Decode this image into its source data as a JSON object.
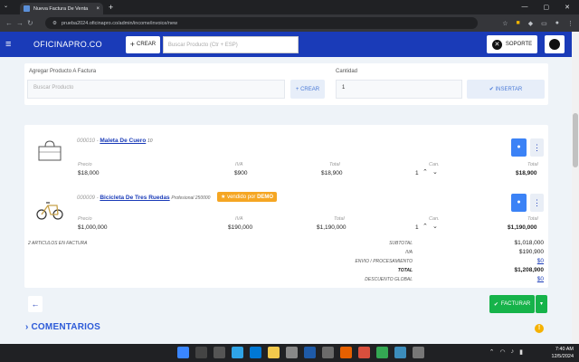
{
  "browser": {
    "tab_title": "Nueva Factura De Venta",
    "tab_close": "×",
    "new_tab": "+",
    "url": "prueba2024.oficinapro.co/admin/income/invoice/new"
  },
  "header": {
    "logo": "OFICINAPRO.CO",
    "crear_label": "CREAR",
    "search_placeholder": "Buscar Producto (Ctr + ESP)",
    "soporte_label": "SOPORTE"
  },
  "add_product": {
    "label": "Agregar Producto A Factura",
    "placeholder": "Buscar Producto",
    "crear_label": "+ CREAR",
    "cantidad_label": "Cantidad",
    "cantidad_value": "1",
    "insertar_label": "✔ INSERTAR"
  },
  "columns": {
    "precio": "Precio",
    "iva": "IVA",
    "total": "Total",
    "can": "Can."
  },
  "items": [
    {
      "code": "000010 - ",
      "name": "Maleta De Cuero",
      "extra": "10",
      "precio": "$18,000",
      "iva": "$900",
      "total": "$18,900",
      "qty": "1",
      "line_total": "$18,900"
    },
    {
      "code": "000009 - ",
      "name": "Bicicleta De Tres Ruedas",
      "extra": "Profesional 250000",
      "badge_text": "vendido por ",
      "badge_strong": "DEMO",
      "precio": "$1,000,000",
      "iva": "$190,000",
      "total": "$1,190,000",
      "qty": "1",
      "line_total": "$1,190,000"
    }
  ],
  "summary": {
    "count_label": "2 ARTICULOS EN FACTURA",
    "subtotal_label": "SUBTOTAL",
    "subtotal": "$1,018,000",
    "iva_label": "IVA",
    "iva": "$190,900",
    "envio_label": "ENVIO / PROCESAMIENTO",
    "envio": "$0",
    "total_label": "TOTAL",
    "total": "$1,208,900",
    "descuento_label": "DESCUENTO GLOBAL",
    "descuento": "$0"
  },
  "footer": {
    "facturar_label": "FACTURAR",
    "comentarios_label": "COMENTARIOS"
  },
  "taskbar": {
    "time": "7:40 AM",
    "date": "12/5/2024"
  },
  "colors": {
    "brand_blue": "#1a3bb8",
    "success_green": "#16b34a",
    "badge_orange": "#f5a623"
  }
}
